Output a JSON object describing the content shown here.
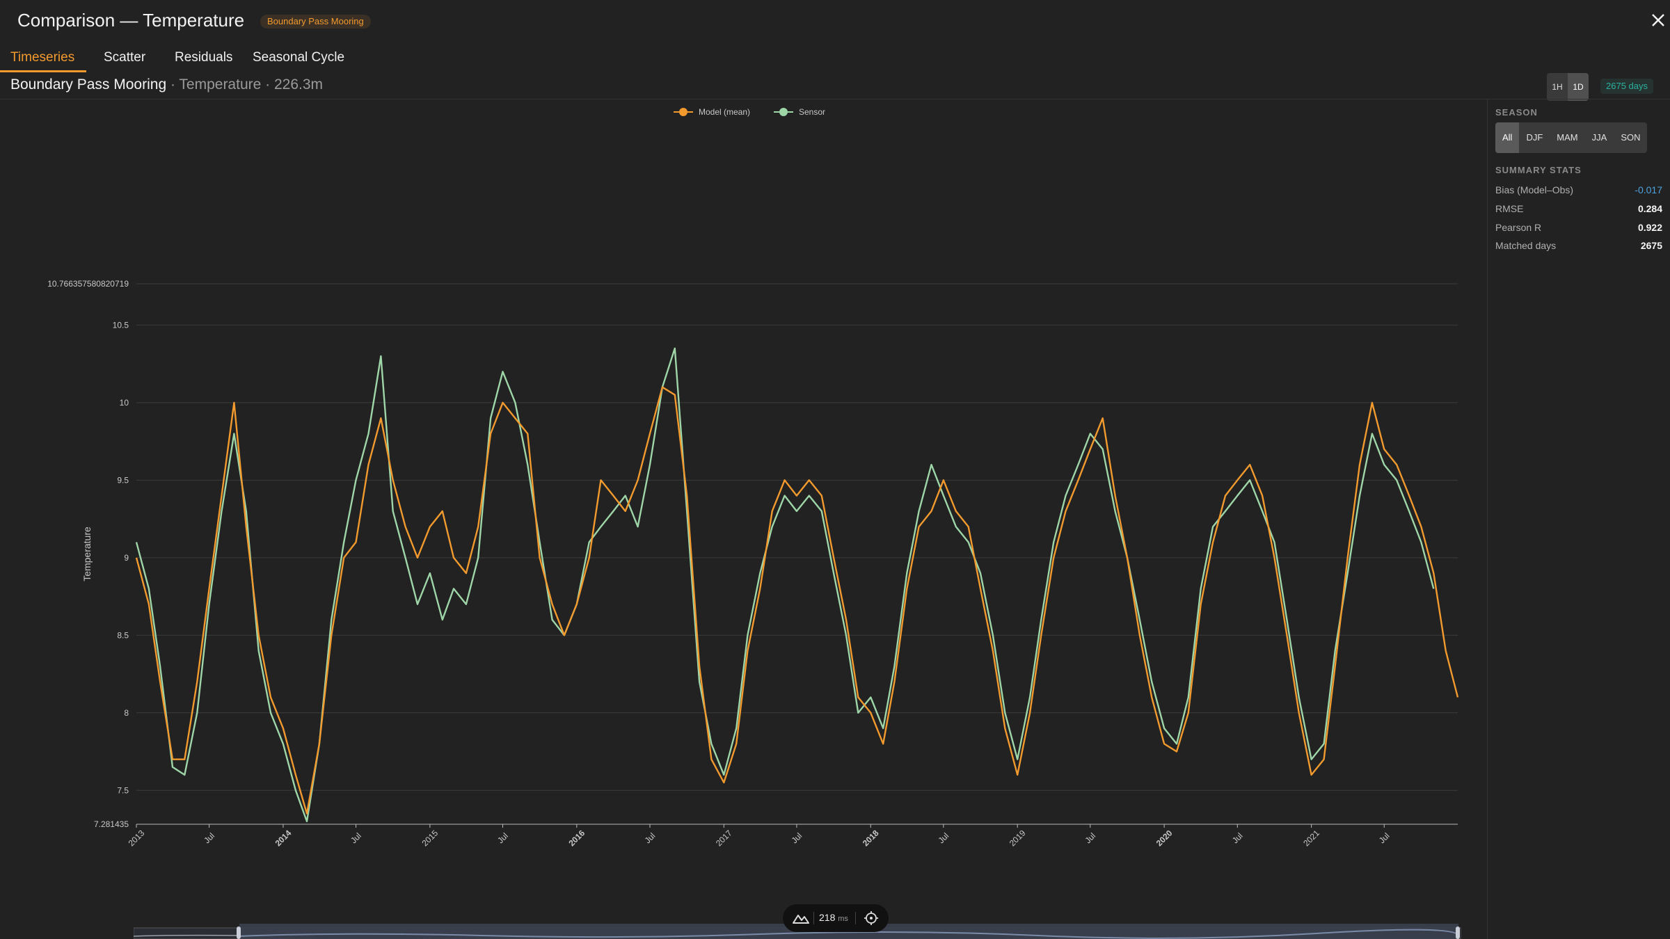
{
  "header": {
    "title": "Comparison — Temperature",
    "badge": "Boundary Pass Mooring"
  },
  "tabs": [
    {
      "label": "Timeseries",
      "active": true
    },
    {
      "label": "Scatter",
      "active": false
    },
    {
      "label": "Residuals",
      "active": false
    },
    {
      "label": "Seasonal Cycle",
      "active": false
    }
  ],
  "subheader": {
    "station": "Boundary Pass Mooring",
    "meta": " · Temperature · 226.3m"
  },
  "resolution": {
    "options": [
      "1H",
      "1D"
    ],
    "selected": "1D"
  },
  "days_badge": "2675 days",
  "sidebar": {
    "season_label": "SEASON",
    "seasons": [
      "All",
      "DJF",
      "MAM",
      "JJA",
      "SON"
    ],
    "season_selected": "All",
    "stats_label": "SUMMARY STATS",
    "stats": [
      {
        "name": "Bias (Model–Obs)",
        "value": "-0.017"
      },
      {
        "name": "RMSE",
        "value": "0.284"
      },
      {
        "name": "Pearson R",
        "value": "0.922"
      },
      {
        "name": "Matched days",
        "value": "2675"
      }
    ]
  },
  "timer": {
    "value": "218",
    "unit": "ms"
  },
  "colors": {
    "model": "#f29a2e",
    "sensor": "#9ed6a8",
    "accent": "#f29a2e",
    "bias": "#4fa3e0"
  },
  "chart_data": {
    "type": "line",
    "ylabel": "Temperature",
    "ylim": [
      7.281435,
      10.766357580820719
    ],
    "yticks": [
      7.281435,
      7.5,
      8,
      8.5,
      9,
      9.5,
      10,
      10.5,
      10.766357580820719
    ],
    "ytick_labels": [
      "7.281435",
      "7.5",
      "8",
      "8.5",
      "9",
      "9.5",
      "10",
      "10.5",
      "10.766357580820719"
    ],
    "xlim": [
      "2013-01-01",
      "2021-12-31"
    ],
    "xticks": [
      {
        "date": "2013-01-01",
        "label": "2013",
        "bold": false
      },
      {
        "date": "2013-07-01",
        "label": "Jul",
        "bold": false
      },
      {
        "date": "2014-01-01",
        "label": "2014",
        "bold": true
      },
      {
        "date": "2014-07-01",
        "label": "Jul",
        "bold": false
      },
      {
        "date": "2015-01-01",
        "label": "2015",
        "bold": false
      },
      {
        "date": "2015-07-01",
        "label": "Jul",
        "bold": false
      },
      {
        "date": "2016-01-01",
        "label": "2016",
        "bold": true
      },
      {
        "date": "2016-07-01",
        "label": "Jul",
        "bold": false
      },
      {
        "date": "2017-01-01",
        "label": "2017",
        "bold": false
      },
      {
        "date": "2017-07-01",
        "label": "Jul",
        "bold": false
      },
      {
        "date": "2018-01-01",
        "label": "2018",
        "bold": true
      },
      {
        "date": "2018-07-01",
        "label": "Jul",
        "bold": false
      },
      {
        "date": "2019-01-01",
        "label": "2019",
        "bold": false
      },
      {
        "date": "2019-07-01",
        "label": "Jul",
        "bold": false
      },
      {
        "date": "2020-01-01",
        "label": "2020",
        "bold": true
      },
      {
        "date": "2020-07-01",
        "label": "Jul",
        "bold": false
      },
      {
        "date": "2021-01-01",
        "label": "2021",
        "bold": false
      },
      {
        "date": "2021-07-01",
        "label": "Jul",
        "bold": false
      }
    ],
    "legend": {
      "placement": "top-center"
    },
    "grid": true,
    "series": [
      {
        "name": "Model (mean)",
        "color": "#f29a2e",
        "points": [
          [
            "2013-01-01",
            9.0
          ],
          [
            "2013-02-01",
            8.7
          ],
          [
            "2013-03-01",
            8.2
          ],
          [
            "2013-04-01",
            7.7
          ],
          [
            "2013-05-01",
            7.7
          ],
          [
            "2013-06-01",
            8.2
          ],
          [
            "2013-07-01",
            8.8
          ],
          [
            "2013-08-01",
            9.4
          ],
          [
            "2013-09-01",
            10.0
          ],
          [
            "2013-10-01",
            9.2
          ],
          [
            "2013-11-01",
            8.5
          ],
          [
            "2013-12-01",
            8.1
          ],
          [
            "2014-01-01",
            7.9
          ],
          [
            "2014-02-01",
            7.6
          ],
          [
            "2014-03-01",
            7.35
          ],
          [
            "2014-04-01",
            7.8
          ],
          [
            "2014-05-01",
            8.5
          ],
          [
            "2014-06-01",
            9.0
          ],
          [
            "2014-07-01",
            9.1
          ],
          [
            "2014-08-01",
            9.6
          ],
          [
            "2014-09-01",
            9.9
          ],
          [
            "2014-10-01",
            9.5
          ],
          [
            "2014-11-01",
            9.2
          ],
          [
            "2014-12-01",
            9.0
          ],
          [
            "2015-01-01",
            9.2
          ],
          [
            "2015-02-01",
            9.3
          ],
          [
            "2015-03-01",
            9.0
          ],
          [
            "2015-04-01",
            8.9
          ],
          [
            "2015-05-01",
            9.2
          ],
          [
            "2015-06-01",
            9.8
          ],
          [
            "2015-07-01",
            10.0
          ],
          [
            "2015-08-01",
            9.9
          ],
          [
            "2015-09-01",
            9.8
          ],
          [
            "2015-10-01",
            9.0
          ],
          [
            "2015-11-01",
            8.7
          ],
          [
            "2015-12-01",
            8.5
          ],
          [
            "2016-01-01",
            8.7
          ],
          [
            "2016-02-01",
            9.0
          ],
          [
            "2016-03-01",
            9.5
          ],
          [
            "2016-04-01",
            9.4
          ],
          [
            "2016-05-01",
            9.3
          ],
          [
            "2016-06-01",
            9.5
          ],
          [
            "2016-07-01",
            9.8
          ],
          [
            "2016-08-01",
            10.1
          ],
          [
            "2016-09-01",
            10.05
          ],
          [
            "2016-10-01",
            9.4
          ],
          [
            "2016-11-01",
            8.3
          ],
          [
            "2016-12-01",
            7.7
          ],
          [
            "2017-01-01",
            7.55
          ],
          [
            "2017-02-01",
            7.8
          ],
          [
            "2017-03-01",
            8.4
          ],
          [
            "2017-04-01",
            8.8
          ],
          [
            "2017-05-01",
            9.3
          ],
          [
            "2017-06-01",
            9.5
          ],
          [
            "2017-07-01",
            9.4
          ],
          [
            "2017-08-01",
            9.5
          ],
          [
            "2017-09-01",
            9.4
          ],
          [
            "2017-10-01",
            9.0
          ],
          [
            "2017-11-01",
            8.6
          ],
          [
            "2017-12-01",
            8.1
          ],
          [
            "2018-01-01",
            8.0
          ],
          [
            "2018-02-01",
            7.8
          ],
          [
            "2018-03-01",
            8.2
          ],
          [
            "2018-04-01",
            8.8
          ],
          [
            "2018-05-01",
            9.2
          ],
          [
            "2018-06-01",
            9.3
          ],
          [
            "2018-07-01",
            9.5
          ],
          [
            "2018-08-01",
            9.3
          ],
          [
            "2018-09-01",
            9.2
          ],
          [
            "2018-10-01",
            8.8
          ],
          [
            "2018-11-01",
            8.4
          ],
          [
            "2018-12-01",
            7.9
          ],
          [
            "2019-01-01",
            7.6
          ],
          [
            "2019-02-01",
            8.0
          ],
          [
            "2019-03-01",
            8.5
          ],
          [
            "2019-04-01",
            9.0
          ],
          [
            "2019-05-01",
            9.3
          ],
          [
            "2019-06-01",
            9.5
          ],
          [
            "2019-07-01",
            9.7
          ],
          [
            "2019-08-01",
            9.9
          ],
          [
            "2019-09-01",
            9.4
          ],
          [
            "2019-10-01",
            9.0
          ],
          [
            "2019-11-01",
            8.5
          ],
          [
            "2019-12-01",
            8.1
          ],
          [
            "2020-01-01",
            7.8
          ],
          [
            "2020-02-01",
            7.75
          ],
          [
            "2020-03-01",
            8.0
          ],
          [
            "2020-04-01",
            8.7
          ],
          [
            "2020-05-01",
            9.1
          ],
          [
            "2020-06-01",
            9.4
          ],
          [
            "2020-07-01",
            9.5
          ],
          [
            "2020-08-01",
            9.6
          ],
          [
            "2020-09-01",
            9.4
          ],
          [
            "2020-10-01",
            9.0
          ],
          [
            "2020-11-01",
            8.5
          ],
          [
            "2020-12-01",
            8.0
          ],
          [
            "2021-01-01",
            7.6
          ],
          [
            "2021-02-01",
            7.7
          ],
          [
            "2021-03-01",
            8.3
          ],
          [
            "2021-04-01",
            9.0
          ],
          [
            "2021-05-01",
            9.6
          ],
          [
            "2021-06-01",
            10.0
          ],
          [
            "2021-07-01",
            9.7
          ],
          [
            "2021-08-01",
            9.6
          ],
          [
            "2021-09-01",
            9.4
          ],
          [
            "2021-10-01",
            9.2
          ],
          [
            "2021-11-01",
            8.9
          ],
          [
            "2021-12-01",
            8.4
          ],
          [
            "2021-12-31",
            8.1
          ]
        ]
      },
      {
        "name": "Sensor",
        "color": "#9ed6a8",
        "points": [
          [
            "2013-01-01",
            9.1
          ],
          [
            "2013-02-01",
            8.8
          ],
          [
            "2013-03-01",
            8.3
          ],
          [
            "2013-04-01",
            7.65
          ],
          [
            "2013-05-01",
            7.6
          ],
          [
            "2013-06-01",
            8.0
          ],
          [
            "2013-07-01",
            8.7
          ],
          [
            "2013-08-01",
            9.3
          ],
          [
            "2013-09-01",
            9.8
          ],
          [
            "2013-10-01",
            9.3
          ],
          [
            "2013-11-01",
            8.4
          ],
          [
            "2013-12-01",
            8.0
          ],
          [
            "2014-01-01",
            7.8
          ],
          [
            "2014-02-01",
            7.5
          ],
          [
            "2014-03-01",
            7.3
          ],
          [
            "2014-04-01",
            7.8
          ],
          [
            "2014-05-01",
            8.6
          ],
          [
            "2014-06-01",
            9.1
          ],
          [
            "2014-07-01",
            9.5
          ],
          [
            "2014-08-01",
            9.8
          ],
          [
            "2014-09-01",
            10.3
          ],
          [
            "2014-10-01",
            9.3
          ],
          [
            "2014-11-01",
            9.0
          ],
          [
            "2014-12-01",
            8.7
          ],
          [
            "2015-01-01",
            8.9
          ],
          [
            "2015-02-01",
            8.6
          ],
          [
            "2015-03-01",
            8.8
          ],
          [
            "2015-04-01",
            8.7
          ],
          [
            "2015-05-01",
            9.0
          ],
          [
            "2015-06-01",
            9.9
          ],
          [
            "2015-07-01",
            10.2
          ],
          [
            "2015-08-01",
            10.0
          ],
          [
            "2015-09-01",
            9.6
          ],
          [
            "2015-10-01",
            9.1
          ],
          [
            "2015-11-01",
            8.6
          ],
          [
            "2015-12-01",
            8.5
          ],
          [
            "2016-01-01",
            8.7
          ],
          [
            "2016-02-01",
            9.1
          ],
          [
            "2016-03-01",
            9.2
          ],
          [
            "2016-04-01",
            9.3
          ],
          [
            "2016-05-01",
            9.4
          ],
          [
            "2016-06-01",
            9.2
          ],
          [
            "2016-07-01",
            9.6
          ],
          [
            "2016-08-01",
            10.1
          ],
          [
            "2016-09-01",
            10.35
          ],
          [
            "2016-10-01",
            9.3
          ],
          [
            "2016-11-01",
            8.2
          ],
          [
            "2016-12-01",
            7.8
          ],
          [
            "2017-01-01",
            7.6
          ],
          [
            "2017-02-01",
            7.9
          ],
          [
            "2017-03-01",
            8.5
          ],
          [
            "2017-04-01",
            8.9
          ],
          [
            "2017-05-01",
            9.2
          ],
          [
            "2017-06-01",
            9.4
          ],
          [
            "2017-07-01",
            9.3
          ],
          [
            "2017-08-01",
            9.4
          ],
          [
            "2017-09-01",
            9.3
          ],
          [
            "2017-10-01",
            8.9
          ],
          [
            "2017-11-01",
            8.5
          ],
          [
            "2017-12-01",
            8.0
          ],
          [
            "2018-01-01",
            8.1
          ],
          [
            "2018-02-01",
            7.9
          ],
          [
            "2018-03-01",
            8.3
          ],
          [
            "2018-04-01",
            8.9
          ],
          [
            "2018-05-01",
            9.3
          ],
          [
            "2018-06-01",
            9.6
          ],
          [
            "2018-07-01",
            9.4
          ],
          [
            "2018-08-01",
            9.2
          ],
          [
            "2018-09-01",
            9.1
          ],
          [
            "2018-10-01",
            8.9
          ],
          [
            "2018-11-01",
            8.5
          ],
          [
            "2018-12-01",
            8.0
          ],
          [
            "2019-01-01",
            7.7
          ],
          [
            "2019-02-01",
            8.1
          ],
          [
            "2019-03-01",
            8.6
          ],
          [
            "2019-04-01",
            9.1
          ],
          [
            "2019-05-01",
            9.4
          ],
          [
            "2019-06-01",
            9.6
          ],
          [
            "2019-07-01",
            9.8
          ],
          [
            "2019-08-01",
            9.7
          ],
          [
            "2019-09-01",
            9.3
          ],
          [
            "2019-10-01",
            9.0
          ],
          [
            "2019-11-01",
            8.6
          ],
          [
            "2019-12-01",
            8.2
          ],
          [
            "2020-01-01",
            7.9
          ],
          [
            "2020-02-01",
            7.8
          ],
          [
            "2020-03-01",
            8.1
          ],
          [
            "2020-04-01",
            8.8
          ],
          [
            "2020-05-01",
            9.2
          ],
          [
            "2020-06-01",
            9.3
          ],
          [
            "2020-07-01",
            9.4
          ],
          [
            "2020-08-01",
            9.5
          ],
          [
            "2020-09-01",
            9.3
          ],
          [
            "2020-10-01",
            9.1
          ],
          [
            "2020-11-01",
            8.6
          ],
          [
            "2020-12-01",
            8.1
          ],
          [
            "2021-01-01",
            7.7
          ],
          [
            "2021-02-01",
            7.8
          ],
          [
            "2021-03-01",
            8.4
          ],
          [
            "2021-04-01",
            8.9
          ],
          [
            "2021-05-01",
            9.4
          ],
          [
            "2021-06-01",
            9.8
          ],
          [
            "2021-07-01",
            9.6
          ],
          [
            "2021-08-01",
            9.5
          ],
          [
            "2021-09-01",
            9.3
          ],
          [
            "2021-10-01",
            9.1
          ],
          [
            "2021-11-01",
            8.8
          ]
        ]
      }
    ]
  }
}
